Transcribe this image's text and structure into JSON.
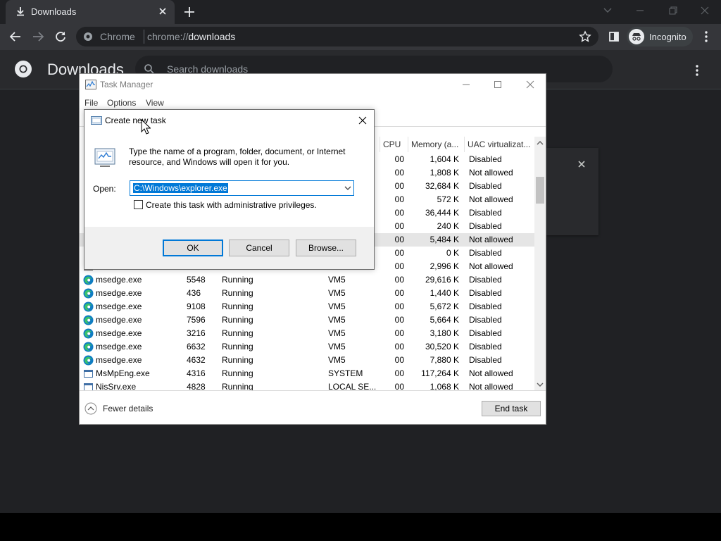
{
  "chrome": {
    "tab_title": "Downloads",
    "omnibox_site": "Chrome",
    "url_scheme": "chrome://",
    "url_host": "downloads",
    "incognito_label": "Incognito",
    "page_title": "Downloads",
    "search_placeholder": "Search downloads"
  },
  "taskmgr": {
    "title": "Task Manager",
    "menu": [
      "File",
      "Options",
      "View"
    ],
    "columns": {
      "cpu": "CPU",
      "memory": "Memory (a...",
      "uac": "UAC virtualizat..."
    },
    "rows": [
      {
        "icon": "",
        "name": "",
        "pid": "",
        "status": "",
        "user": "",
        "cpu": "00",
        "mem": "1,604 K",
        "uac": "Disabled"
      },
      {
        "icon": "",
        "name": "",
        "pid": "",
        "status": "",
        "user": "",
        "cpu": "00",
        "mem": "1,808 K",
        "uac": "Not allowed"
      },
      {
        "icon": "",
        "name": "",
        "pid": "",
        "status": "",
        "user": "",
        "cpu": "00",
        "mem": "32,684 K",
        "uac": "Disabled"
      },
      {
        "icon": "",
        "name": "",
        "pid": "",
        "status": "",
        "user": "",
        "cpu": "00",
        "mem": "572 K",
        "uac": "Not allowed"
      },
      {
        "icon": "",
        "name": "",
        "pid": "",
        "status": "",
        "user": "",
        "cpu": "00",
        "mem": "36,444 K",
        "uac": "Disabled"
      },
      {
        "icon": "",
        "name": "",
        "pid": "",
        "status": "",
        "user": "",
        "cpu": "00",
        "mem": "240 K",
        "uac": "Disabled"
      },
      {
        "icon": "",
        "name": "",
        "pid": "",
        "status": "",
        "user": "",
        "cpu": "00",
        "mem": "5,484 K",
        "uac": "Not allowed",
        "selected": true
      },
      {
        "icon": "",
        "name": "",
        "pid": "",
        "status": "",
        "user": "",
        "cpu": "00",
        "mem": "0 K",
        "uac": "Disabled"
      },
      {
        "icon": "",
        "name": "",
        "pid": "",
        "status": "",
        "user": "",
        "cpu": "00",
        "mem": "2,996 K",
        "uac": "Not allowed"
      },
      {
        "icon": "edge-icon",
        "name": "msedge.exe",
        "pid": "5548",
        "status": "Running",
        "user": "VM5",
        "cpu": "00",
        "mem": "29,616 K",
        "uac": "Disabled"
      },
      {
        "icon": "edge-icon",
        "name": "msedge.exe",
        "pid": "436",
        "status": "Running",
        "user": "VM5",
        "cpu": "00",
        "mem": "1,440 K",
        "uac": "Disabled"
      },
      {
        "icon": "edge-icon",
        "name": "msedge.exe",
        "pid": "9108",
        "status": "Running",
        "user": "VM5",
        "cpu": "00",
        "mem": "5,672 K",
        "uac": "Disabled"
      },
      {
        "icon": "edge-icon",
        "name": "msedge.exe",
        "pid": "7596",
        "status": "Running",
        "user": "VM5",
        "cpu": "00",
        "mem": "5,664 K",
        "uac": "Disabled"
      },
      {
        "icon": "edge-icon",
        "name": "msedge.exe",
        "pid": "3216",
        "status": "Running",
        "user": "VM5",
        "cpu": "00",
        "mem": "3,180 K",
        "uac": "Disabled"
      },
      {
        "icon": "edge-icon",
        "name": "msedge.exe",
        "pid": "6632",
        "status": "Running",
        "user": "VM5",
        "cpu": "00",
        "mem": "30,520 K",
        "uac": "Disabled"
      },
      {
        "icon": "edge-icon",
        "name": "msedge.exe",
        "pid": "4632",
        "status": "Running",
        "user": "VM5",
        "cpu": "00",
        "mem": "7,880 K",
        "uac": "Disabled"
      },
      {
        "icon": "window-icon",
        "name": "MsMpEng.exe",
        "pid": "4316",
        "status": "Running",
        "user": "SYSTEM",
        "cpu": "00",
        "mem": "117,264 K",
        "uac": "Not allowed"
      },
      {
        "icon": "window-icon",
        "name": "NisSrv.exe",
        "pid": "4828",
        "status": "Running",
        "user": "LOCAL SE...",
        "cpu": "00",
        "mem": "1,068 K",
        "uac": "Not allowed"
      }
    ],
    "fewer_details": "Fewer details",
    "end_task": "End task"
  },
  "runbox": {
    "title": "Create new task",
    "description": "Type the name of a program, folder, document, or Internet resource, and Windows will open it for you.",
    "open_label": "Open:",
    "open_value": "C:\\Windows\\explorer.exe",
    "admin_label": "Create this task with administrative privileges.",
    "ok": "OK",
    "cancel": "Cancel",
    "browse": "Browse..."
  },
  "colors": {
    "chrome_bg": "#202124",
    "selection_blue": "#0078d7",
    "edge_blue": "#0f7dc2",
    "edge_green": "#3ac26b"
  }
}
